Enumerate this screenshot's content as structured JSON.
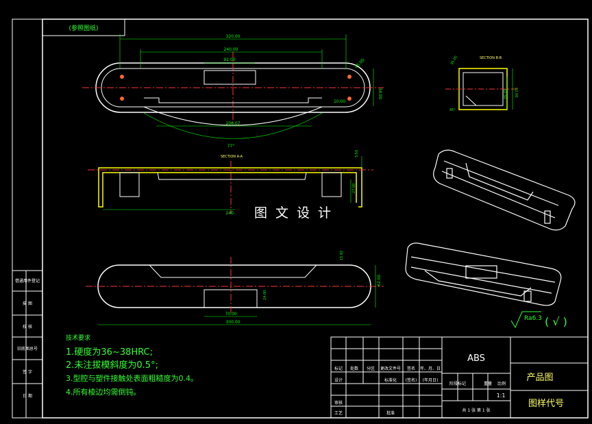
{
  "colors": {
    "frame": "#ffffff",
    "outline": "#ffffff",
    "centerline": "#ff3333",
    "dimension": "#00ff00",
    "hidden": "#ffff00",
    "text_green": "#33ff33",
    "text_yellow": "#ffff66",
    "text_white": "#ffffff"
  },
  "header_tab": "(参照图纸)",
  "watermark": "图文设计",
  "section_bb": "SECTION B-B",
  "section_aa": "SECTION A-A",
  "dims": {
    "top_width": "320.00",
    "mid_width": "240.00",
    "center_width": "92.00",
    "r_angle": "45.00",
    "right_h": "34.00",
    "right_radius": "10.00",
    "arc_width": "206.07",
    "angle": "77°",
    "bb_top": "35.00",
    "bb_h1": "52.50",
    "bb_h2": "62.00",
    "bb_angle": "45°",
    "aa_t": "3.50",
    "aa_h": "27.00",
    "aa_w": "240.00",
    "bot_h1": "15.92",
    "bot_h2": "62.00",
    "bot_w1": "70.00",
    "bot_w2": "300.00",
    "bot_small": "24.00"
  },
  "roughness": "Ra6.3",
  "roughness_paren": "( √ )",
  "tech": {
    "title": "技术要求",
    "lines": [
      "1.硬度为36~38HRC;",
      "2.未注拔模斜度为0.5°;",
      "3.型腔与塑件接触处表面粗糙度为0.4。",
      "4.所有棱边均需倒钝。"
    ]
  },
  "side_labels": [
    "借通用件登记",
    "描  图",
    "校  核",
    "旧底图总号",
    "签  字",
    "日  期"
  ],
  "title_block": {
    "material": "ABS",
    "product": "产品图",
    "drawing_no": "图样代号",
    "scale": "1:1",
    "row_labels": [
      "标记",
      "处数",
      "分区",
      "更改文件号",
      "签名",
      "年、月、日"
    ],
    "design": "设计",
    "standardize": "标准化",
    "sign": "(签名)",
    "date": "(年月日)",
    "stage_labels": [
      "阶段标记",
      "重量",
      "比例"
    ],
    "review": "审核",
    "process": "工艺",
    "approve": "批准",
    "sheets": "共 1 张   第 1 张"
  }
}
